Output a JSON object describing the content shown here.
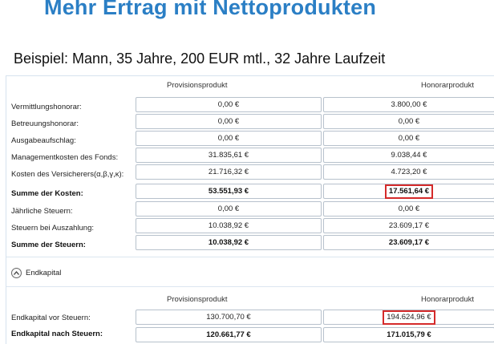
{
  "title": "Mehr Ertrag mit Nettoprodukten",
  "subtitle": "Beispiel: Mann, 35 Jahre, 200 EUR mtl., 32 Jahre Laufzeit",
  "columns": {
    "provision": "Provisionsprodukt",
    "honorar": "Honorarprodukt"
  },
  "cost_rows": [
    {
      "label": "Vermittlungshonorar:",
      "provision": "0,00 €",
      "honorar": "3.800,00 €"
    },
    {
      "label": "Betreuungshonorar:",
      "provision": "0,00 €",
      "honorar": "0,00 €"
    },
    {
      "label": "Ausgabeaufschlag:",
      "provision": "0,00 €",
      "honorar": "0,00 €"
    },
    {
      "label": "Managementkosten des Fonds:",
      "provision": "31.835,61 €",
      "honorar": "9.038,44 €"
    },
    {
      "label": "Kosten des Versicherers(α,β,γ,κ):",
      "provision": "21.716,32 €",
      "honorar": "4.723,20 €"
    },
    {
      "label": "Summe der Kosten:",
      "provision": "53.551,93 €",
      "honorar": "17.561,64 €"
    },
    {
      "label": "Jährliche Steuern:",
      "provision": "0,00 €",
      "honorar": "0,00 €"
    },
    {
      "label": "Steuern bei Auszahlung:",
      "provision": "10.038,92 €",
      "honorar": "23.609,17 €"
    },
    {
      "label": "Summe der Steuern:",
      "provision": "10.038,92 €",
      "honorar": "23.609,17 €"
    }
  ],
  "endkapital": {
    "toggle_label": "Endkapital",
    "toggle_icon": "chevron-up-icon",
    "rows": [
      {
        "label": "Endkapital vor Steuern:",
        "provision": "130.700,70 €",
        "honorar": "194.624,96 €"
      },
      {
        "label": "Endkapital nach Steuern:",
        "provision": "120.661,77 €",
        "honorar": "171.015,79 €"
      }
    ]
  },
  "colors": {
    "title": "#2b7fc5",
    "highlight": "#d42a2a"
  }
}
